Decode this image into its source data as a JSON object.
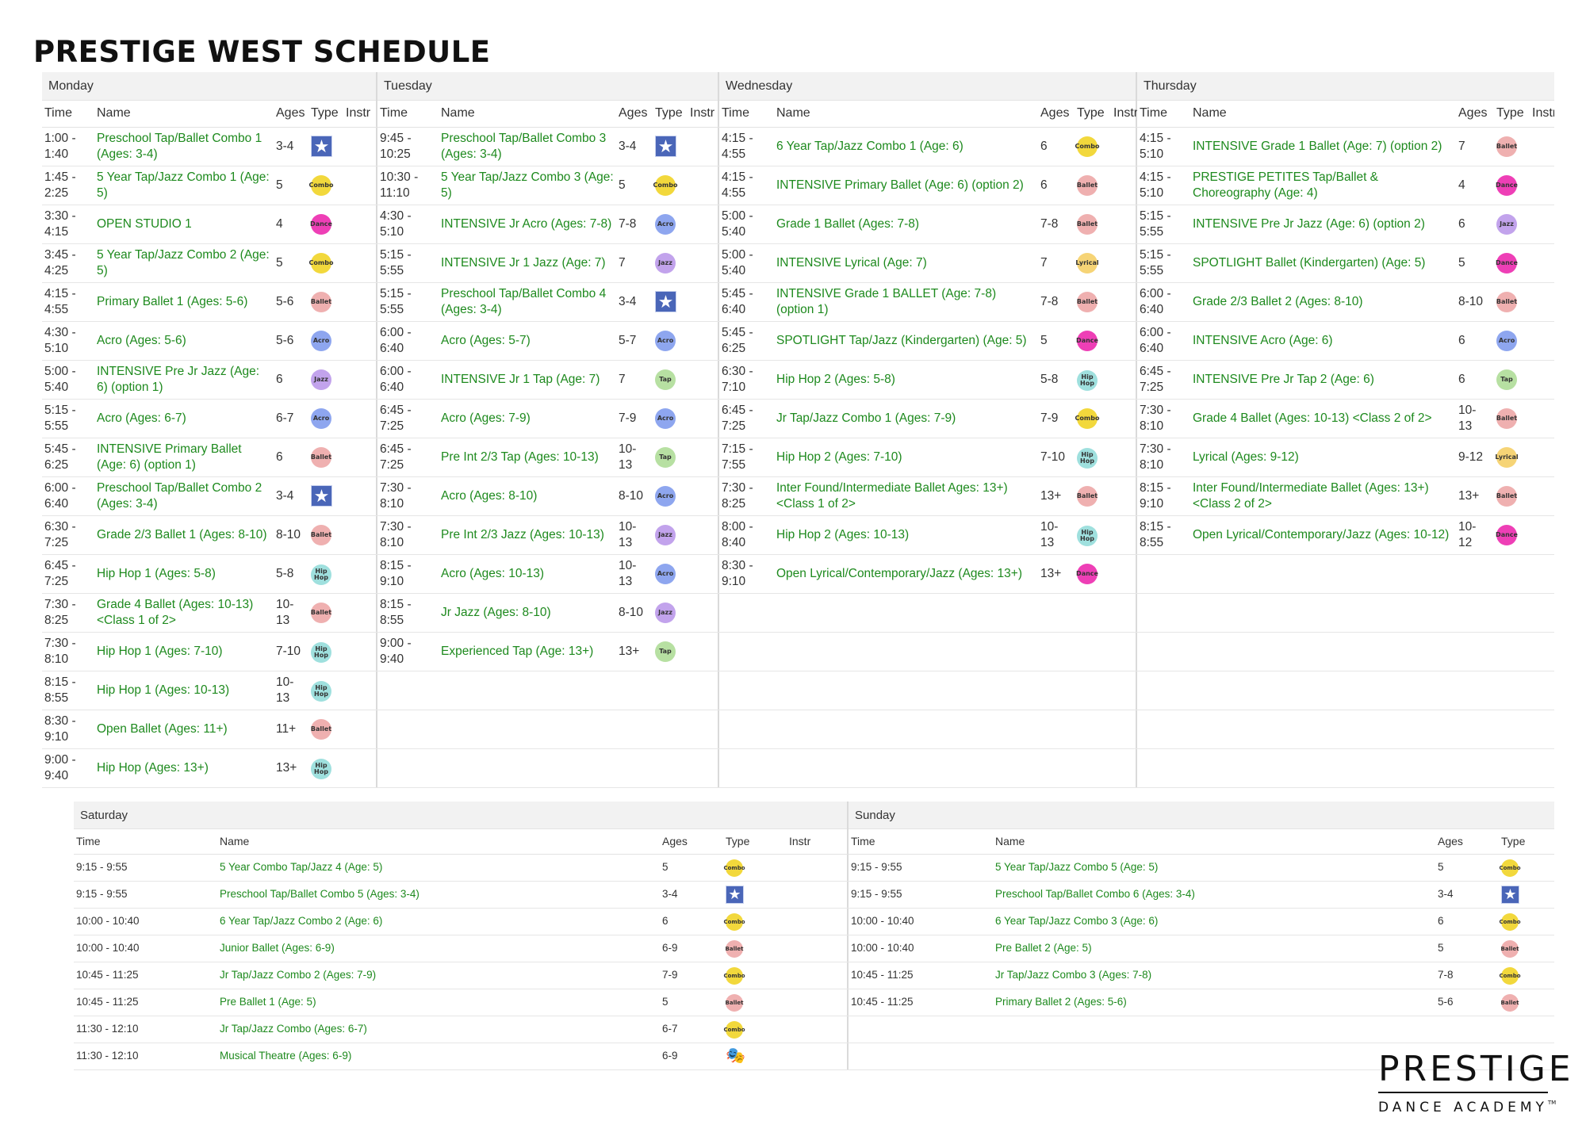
{
  "title": "PRESTIGE WEST SCHEDULE",
  "headers": {
    "time": "Time",
    "name": "Name",
    "ages": "Ages",
    "type": "Type",
    "instr": "Instr"
  },
  "badges": {
    "combo": "Combo",
    "ballet": "Ballet",
    "dance": "Dance",
    "acro": "Acro",
    "jazz": "Jazz",
    "tap": "Tap",
    "hiphop": "Hip\nHop",
    "lyrical": "Lyrical"
  },
  "icons": {
    "star": "star-person-icon",
    "mask": "theater-masks-icon",
    "star_glyph": "★",
    "mask_glyph": "🎭"
  },
  "colors": {
    "class_name": "#1e8a1e",
    "open_studio": "#c00000",
    "combo": "#f2d83c",
    "ballet": "#efb0b0",
    "dance": "#ee3fb6",
    "acro": "#8ea6ef",
    "jazz": "#c2a3ec",
    "tap": "#b7e0a2",
    "hiphop": "#9fe0de",
    "lyrical": "#f6d476"
  },
  "top_days": [
    {
      "day": "Monday",
      "classes": [
        {
          "time": "1:00 -\n1:40",
          "name": "Preschool Tap/Ballet Combo 1 (Ages: 3-4)",
          "ages": "3-4",
          "type": "star"
        },
        {
          "time": "1:45 -\n2:25",
          "name": "5 Year Tap/Jazz Combo 1 (Age: 5)",
          "ages": "5",
          "type": "combo"
        },
        {
          "time": "3:30 -\n4:15",
          "name": "OPEN STUDIO 1",
          "ages": "4",
          "type": "dance",
          "open": true
        },
        {
          "time": "3:45 -\n4:25",
          "name": "5 Year Tap/Jazz Combo 2 (Age: 5)",
          "ages": "5",
          "type": "combo"
        },
        {
          "time": "4:15 -\n4:55",
          "name": "Primary Ballet 1 (Ages: 5-6)",
          "ages": "5-6",
          "type": "ballet"
        },
        {
          "time": "4:30 -\n5:10",
          "name": "Acro (Ages: 5-6)",
          "ages": "5-6",
          "type": "acro"
        },
        {
          "time": "5:00 -\n5:40",
          "name": "INTENSIVE Pre Jr Jazz (Age: 6) (option 1)",
          "ages": "6",
          "type": "jazz"
        },
        {
          "time": "5:15 -\n5:55",
          "name": "Acro (Ages: 6-7)",
          "ages": "6-7",
          "type": "acro"
        },
        {
          "time": "5:45 -\n6:25",
          "name": "INTENSIVE Primary Ballet (Age: 6) (option 1)",
          "ages": "6",
          "type": "ballet"
        },
        {
          "time": "6:00 -\n6:40",
          "name": "Preschool Tap/Ballet Combo 2 (Ages: 3-4)",
          "ages": "3-4",
          "type": "star"
        },
        {
          "time": "6:30 -\n7:25",
          "name": "Grade 2/3 Ballet 1 (Ages: 8-10)",
          "ages": "8-10",
          "type": "ballet"
        },
        {
          "time": "6:45 -\n7:25",
          "name": "Hip Hop 1 (Ages: 5-8)",
          "ages": "5-8",
          "type": "hiphop"
        },
        {
          "time": "7:30 -\n8:25",
          "name": "Grade 4 Ballet (Ages: 10-13) <Class 1 of 2>",
          "ages": "10-\n13",
          "type": "ballet"
        },
        {
          "time": "7:30 -\n8:10",
          "name": "Hip Hop 1 (Ages: 7-10)",
          "ages": "7-10",
          "type": "hiphop"
        },
        {
          "time": "8:15 -\n8:55",
          "name": "Hip Hop 1 (Ages: 10-13)",
          "ages": "10-\n13",
          "type": "hiphop"
        },
        {
          "time": "8:30 -\n9:10",
          "name": "Open Ballet (Ages: 11+)",
          "ages": "11+",
          "type": "ballet"
        },
        {
          "time": "9:00 -\n9:40",
          "name": "Hip Hop (Ages: 13+)",
          "ages": "13+",
          "type": "hiphop"
        }
      ]
    },
    {
      "day": "Tuesday",
      "classes": [
        {
          "time": "9:45 -\n10:25",
          "name": "Preschool Tap/Ballet Combo 3 (Ages: 3-4)",
          "ages": "3-4",
          "type": "star"
        },
        {
          "time": "10:30 -\n11:10",
          "name": "5 Year Tap/Jazz Combo 3 (Age: 5)",
          "ages": "5",
          "type": "combo"
        },
        {
          "time": "4:30 -\n5:10",
          "name": "INTENSIVE Jr Acro (Ages: 7-8)",
          "ages": "7-8",
          "type": "acro"
        },
        {
          "time": "5:15 -\n5:55",
          "name": "INTENSIVE Jr 1 Jazz (Age: 7)",
          "ages": "7",
          "type": "jazz"
        },
        {
          "time": "5:15 -\n5:55",
          "name": "Preschool Tap/Ballet Combo 4 (Ages: 3-4)",
          "ages": "3-4",
          "type": "star"
        },
        {
          "time": "6:00 -\n6:40",
          "name": "Acro (Ages: 5-7)",
          "ages": "5-7",
          "type": "acro"
        },
        {
          "time": "6:00 -\n6:40",
          "name": "INTENSIVE Jr 1 Tap (Age: 7)",
          "ages": "7",
          "type": "tap"
        },
        {
          "time": "6:45 -\n7:25",
          "name": "Acro (Ages: 7-9)",
          "ages": "7-9",
          "type": "acro"
        },
        {
          "time": "6:45 -\n7:25",
          "name": "Pre Int 2/3 Tap (Ages: 10-13)",
          "ages": "10-\n13",
          "type": "tap"
        },
        {
          "time": "7:30 -\n8:10",
          "name": "Acro (Ages: 8-10)",
          "ages": "8-10",
          "type": "acro"
        },
        {
          "time": "7:30 -\n8:10",
          "name": "Pre Int 2/3 Jazz (Ages: 10-13)",
          "ages": "10-\n13",
          "type": "jazz"
        },
        {
          "time": "8:15 -\n9:10",
          "name": "Acro (Ages: 10-13)",
          "ages": "10-\n13",
          "type": "acro"
        },
        {
          "time": "8:15 -\n8:55",
          "name": "Jr Jazz (Ages: 8-10)",
          "ages": "8-10",
          "type": "jazz"
        },
        {
          "time": "9:00 -\n9:40",
          "name": "Experienced Tap (Age: 13+)",
          "ages": "13+",
          "type": "tap"
        }
      ]
    },
    {
      "day": "Wednesday",
      "classes": [
        {
          "time": "4:15 -\n4:55",
          "name": "6 Year Tap/Jazz Combo 1 (Age: 6)",
          "ages": "6",
          "type": "combo"
        },
        {
          "time": "4:15 -\n4:55",
          "name": "INTENSIVE Primary Ballet (Age: 6) (option 2)",
          "ages": "6",
          "type": "ballet"
        },
        {
          "time": "5:00 -\n5:40",
          "name": "Grade 1 Ballet (Ages: 7-8)",
          "ages": "7-8",
          "type": "ballet"
        },
        {
          "time": "5:00 -\n5:40",
          "name": "INTENSIVE Lyrical (Age: 7)",
          "ages": "7",
          "type": "lyrical"
        },
        {
          "time": "5:45 -\n6:40",
          "name": "INTENSIVE Grade 1 BALLET (Age: 7-8) (option 1)",
          "ages": "7-8",
          "type": "ballet"
        },
        {
          "time": "5:45 -\n6:25",
          "name": "SPOTLIGHT Tap/Jazz (Kindergarten) (Age: 5)",
          "ages": "5",
          "type": "dance"
        },
        {
          "time": "6:30 -\n7:10",
          "name": "Hip Hop 2 (Ages: 5-8)",
          "ages": "5-8",
          "type": "hiphop"
        },
        {
          "time": "6:45 -\n7:25",
          "name": "Jr Tap/Jazz Combo 1 (Ages: 7-9)",
          "ages": "7-9",
          "type": "combo"
        },
        {
          "time": "7:15 -\n7:55",
          "name": "Hip Hop 2 (Ages: 7-10)",
          "ages": "7-10",
          "type": "hiphop"
        },
        {
          "time": "7:30 -\n8:25",
          "name": "Inter Found/Intermediate Ballet Ages: 13+) <Class 1 of 2>",
          "ages": "13+",
          "type": "ballet"
        },
        {
          "time": "8:00 -\n8:40",
          "name": "Hip Hop 2 (Ages: 10-13)",
          "ages": "10-\n13",
          "type": "hiphop"
        },
        {
          "time": "8:30 -\n9:10",
          "name": "Open Lyrical/Contemporary/Jazz (Ages: 13+)",
          "ages": "13+",
          "type": "dance"
        }
      ]
    },
    {
      "day": "Thursday",
      "classes": [
        {
          "time": "4:15 -\n5:10",
          "name": "INTENSIVE Grade 1 Ballet (Age: 7) (option 2)",
          "ages": "7",
          "type": "ballet"
        },
        {
          "time": "4:15 -\n5:10",
          "name": "PRESTIGE PETITES Tap/Ballet & Choreography (Age: 4)",
          "ages": "4",
          "type": "dance"
        },
        {
          "time": "5:15 -\n5:55",
          "name": "INTENSIVE Pre Jr Jazz (Age: 6) (option 2)",
          "ages": "6",
          "type": "jazz"
        },
        {
          "time": "5:15 -\n5:55",
          "name": "SPOTLIGHT Ballet (Kindergarten) (Age: 5)",
          "ages": "5",
          "type": "dance"
        },
        {
          "time": "6:00 -\n6:40",
          "name": "Grade 2/3 Ballet 2 (Ages: 8-10)",
          "ages": "8-10",
          "type": "ballet"
        },
        {
          "time": "6:00 -\n6:40",
          "name": "INTENSIVE Acro (Age: 6)",
          "ages": "6",
          "type": "acro"
        },
        {
          "time": "6:45 -\n7:25",
          "name": "INTENSIVE Pre Jr Tap 2 (Age: 6)",
          "ages": "6",
          "type": "tap"
        },
        {
          "time": "7:30 -\n8:10",
          "name": "Grade 4 Ballet (Ages: 10-13) <Class 2 of 2>",
          "ages": "10-\n13",
          "type": "ballet"
        },
        {
          "time": "7:30 -\n8:10",
          "name": "Lyrical (Ages: 9-12)",
          "ages": "9-12",
          "type": "lyrical"
        },
        {
          "time": "8:15 -\n9:10",
          "name": "Inter Found/Intermediate Ballet (Ages: 13+) <Class 2 of 2>",
          "ages": "13+",
          "type": "ballet"
        },
        {
          "time": "8:15 -\n8:55",
          "name": "Open Lyrical/Contemporary/Jazz (Ages: 10-12)",
          "ages": "10-\n12",
          "type": "dance"
        }
      ]
    }
  ],
  "bottom_days": [
    {
      "day": "Saturday",
      "classes": [
        {
          "time": "9:15 - 9:55",
          "name": "5 Year Combo Tap/Jazz 4 (Age: 5)",
          "ages": "5",
          "type": "combo"
        },
        {
          "time": "9:15 - 9:55",
          "name": "Preschool Tap/Ballet Combo 5 (Ages: 3-4)",
          "ages": "3-4",
          "type": "star"
        },
        {
          "time": "10:00 - 10:40",
          "name": "6 Year Tap/Jazz Combo 2 (Age: 6)",
          "ages": "6",
          "type": "combo"
        },
        {
          "time": "10:00 - 10:40",
          "name": "Junior Ballet (Ages: 6-9)",
          "ages": "6-9",
          "type": "ballet"
        },
        {
          "time": "10:45 - 11:25",
          "name": "Jr Tap/Jazz Combo 2 (Ages: 7-9)",
          "ages": "7-9",
          "type": "combo"
        },
        {
          "time": "10:45 - 11:25",
          "name": "Pre Ballet 1 (Age: 5)",
          "ages": "5",
          "type": "ballet"
        },
        {
          "time": "11:30 - 12:10",
          "name": "Jr Tap/Jazz Combo (Ages: 6-7)",
          "ages": "6-7",
          "type": "combo"
        },
        {
          "time": "11:30 - 12:10",
          "name": "Musical Theatre (Ages: 6-9)",
          "ages": "6-9",
          "type": "mask"
        }
      ]
    },
    {
      "day": "Sunday",
      "classes": [
        {
          "time": "9:15 - 9:55",
          "name": "5 Year Tap/Jazz Combo 5 (Age: 5)",
          "ages": "5",
          "type": "combo"
        },
        {
          "time": "9:15 - 9:55",
          "name": "Preschool Tap/Ballet Combo 6 (Ages: 3-4)",
          "ages": "3-4",
          "type": "star"
        },
        {
          "time": "10:00 - 10:40",
          "name": "6 Year Tap/Jazz Combo 3 (Age: 6)",
          "ages": "6",
          "type": "combo"
        },
        {
          "time": "10:00 - 10:40",
          "name": "Pre Ballet 2 (Age: 5)",
          "ages": "5",
          "type": "ballet"
        },
        {
          "time": "10:45 - 11:25",
          "name": "Jr Tap/Jazz Combo 3 (Ages: 7-8)",
          "ages": "7-8",
          "type": "combo"
        },
        {
          "time": "10:45 - 11:25",
          "name": "Primary Ballet 2 (Ages: 5-6)",
          "ages": "5-6",
          "type": "ballet"
        }
      ]
    }
  ],
  "brand": {
    "name": "PRESTIGE",
    "sub": "DANCE ACADEMY",
    "tm": "TM"
  }
}
